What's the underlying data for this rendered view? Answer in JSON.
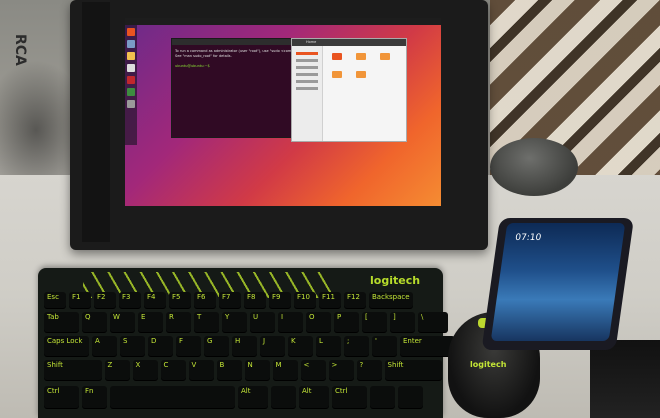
{
  "photo": {
    "brand_rca": "RCA",
    "keyboard": {
      "brand": "logitech",
      "rows": [
        [
          "Esc",
          "F1",
          "F2",
          "F3",
          "F4",
          "F5",
          "F6",
          "F7",
          "F8",
          "F9",
          "F10",
          "F11",
          "F12",
          "Backspace"
        ],
        [
          "Tab",
          "Q",
          "W",
          "E",
          "R",
          "T",
          "Y",
          "U",
          "I",
          "O",
          "P",
          "[",
          "]",
          "\\"
        ],
        [
          "Caps Lock",
          "A",
          "S",
          "D",
          "F",
          "G",
          "H",
          "J",
          "K",
          "L",
          ";",
          "'",
          "Enter"
        ],
        [
          "Shift",
          "Z",
          "X",
          "C",
          "V",
          "B",
          "N",
          "M",
          "<",
          ">",
          "?",
          "Shift"
        ],
        [
          "Ctrl",
          "Fn",
          "",
          "Alt",
          "",
          "Alt",
          "Ctrl",
          "",
          ""
        ]
      ]
    },
    "mouse": {
      "brand": "logitech"
    },
    "phone": {
      "time": "07:10"
    },
    "tablet_screen": {
      "os": "Ubuntu",
      "terminal_lines": [
        "To run a command as administrator (user \"root\"), use \"sudo <command>\".",
        "See \"man sudo_root\" for details.",
        "",
        "ubuntu@ubuntu:~$"
      ],
      "files_title": "Home"
    },
    "colors": {
      "accent_green": "#b7dc2b",
      "ubuntu_orange": "#e95420",
      "ubuntu_purple": "#6b2a8a"
    }
  }
}
